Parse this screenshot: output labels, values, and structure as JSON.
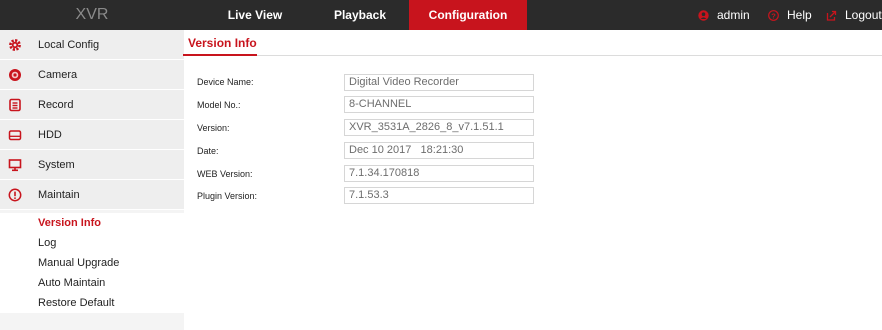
{
  "header": {
    "logo": "XVR",
    "tabs": [
      {
        "label": "Live View"
      },
      {
        "label": "Playback"
      },
      {
        "label": "Configuration",
        "active": true
      }
    ],
    "user": "admin",
    "help": "Help",
    "logout": "Logout"
  },
  "sidebar": {
    "items": [
      {
        "label": "Local Config",
        "icon": "gear-icon"
      },
      {
        "label": "Camera",
        "icon": "camera-icon"
      },
      {
        "label": "Record",
        "icon": "record-icon"
      },
      {
        "label": "HDD",
        "icon": "hdd-icon"
      },
      {
        "label": "System",
        "icon": "monitor-icon"
      },
      {
        "label": "Maintain",
        "icon": "info-icon"
      }
    ],
    "subitems": [
      {
        "label": "Version Info",
        "active": true
      },
      {
        "label": "Log"
      },
      {
        "label": "Manual Upgrade"
      },
      {
        "label": "Auto Maintain"
      },
      {
        "label": "Restore Default"
      }
    ]
  },
  "content": {
    "tab": "Version Info",
    "fields": [
      {
        "label": "Device Name:",
        "value": "Digital Video Recorder"
      },
      {
        "label": "Model No.:",
        "value": "8-CHANNEL"
      },
      {
        "label": "Version:",
        "value": "XVR_3531A_2826_8_v7.1.51.1"
      },
      {
        "label": "Date:",
        "value": "Dec 10 2017   18:21:30"
      },
      {
        "label": "WEB Version:",
        "value": "7.1.34.170818"
      },
      {
        "label": "Plugin Version:",
        "value": "7.1.53.3"
      }
    ]
  },
  "colors": {
    "accent": "#c8141d",
    "topbar": "#2b2b2b",
    "sidebar": "#eeeeee"
  }
}
